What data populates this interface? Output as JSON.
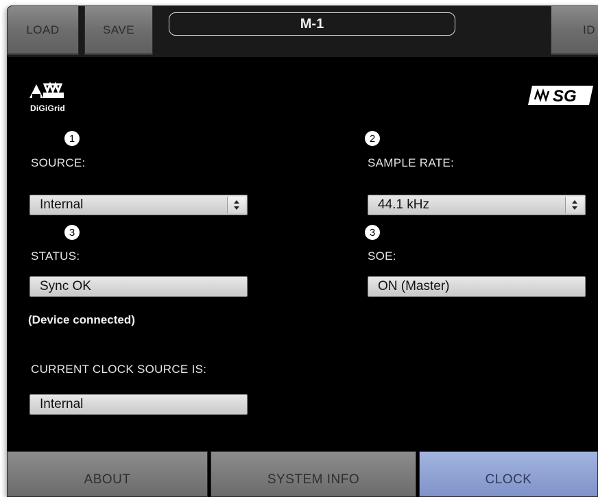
{
  "toolbar": {
    "load_label": "LOAD",
    "save_label": "SAVE",
    "device_name": "M-1",
    "id_label": "ID"
  },
  "logos": {
    "left_brand": "DiGiGrid",
    "right_brand": "SG"
  },
  "source": {
    "badge": "1",
    "label": "SOURCE:",
    "value": "Internal"
  },
  "sample_rate": {
    "badge": "2",
    "label": "SAMPLE RATE:",
    "value": "44.1 kHz"
  },
  "status": {
    "badge": "3",
    "label": "STATUS:",
    "value": "Sync OK",
    "note": "(Device connected)"
  },
  "soe": {
    "badge": "3",
    "label": "SOE:",
    "value": "ON (Master)"
  },
  "current_clock": {
    "label": "CURRENT CLOCK SOURCE IS:",
    "value": "Internal"
  },
  "tabs": [
    {
      "label": "ABOUT",
      "active": false
    },
    {
      "label": "SYSTEM INFO",
      "active": false
    },
    {
      "label": "CLOCK",
      "active": true
    }
  ],
  "colors": {
    "background": "#000000",
    "active_tab": "#8fa2d6",
    "inactive_tab": "#7a7a7a",
    "field": "#d6d6d6"
  }
}
